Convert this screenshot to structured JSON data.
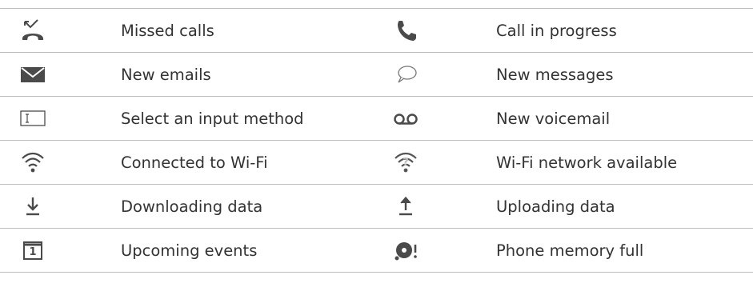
{
  "rows": [
    {
      "left": {
        "icon": "missed-call-icon",
        "label": "Missed calls"
      },
      "right": {
        "icon": "phone-call-icon",
        "label": "Call in progress"
      }
    },
    {
      "left": {
        "icon": "email-icon",
        "label": "New emails"
      },
      "right": {
        "icon": "message-bubble-icon",
        "label": "New messages"
      }
    },
    {
      "left": {
        "icon": "input-method-icon",
        "label": "Select an input method"
      },
      "right": {
        "icon": "voicemail-icon",
        "label": "New voicemail"
      }
    },
    {
      "left": {
        "icon": "wifi-connected-icon",
        "label": "Connected to Wi-Fi"
      },
      "right": {
        "icon": "wifi-available-icon",
        "label": "Wi-Fi network available"
      }
    },
    {
      "left": {
        "icon": "download-icon",
        "label": "Downloading data"
      },
      "right": {
        "icon": "upload-icon",
        "label": "Uploading data"
      }
    },
    {
      "left": {
        "icon": "calendar-event-icon",
        "label": "Upcoming events",
        "calendar_day": "1"
      },
      "right": {
        "icon": "memory-full-icon",
        "label": "Phone memory full"
      }
    }
  ],
  "colors": {
    "icon": "#4a4a4a",
    "text": "#333333",
    "divider": "#bdbdbd"
  }
}
